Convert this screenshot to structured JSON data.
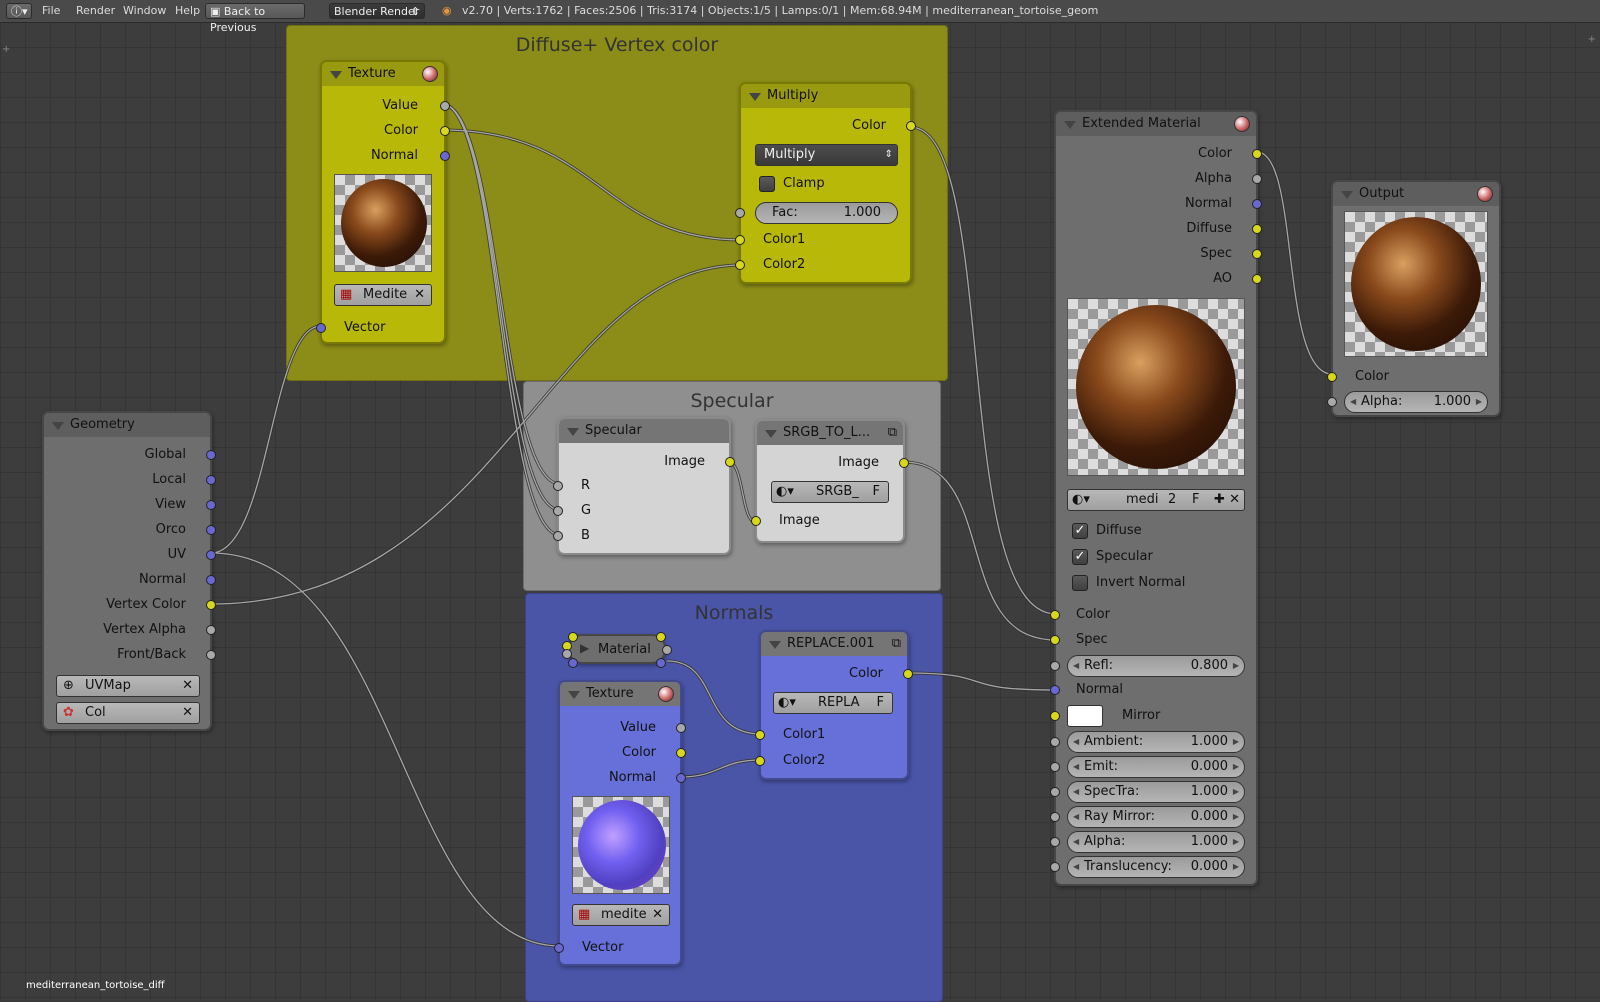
{
  "topbar": {
    "menus": [
      "File",
      "Render",
      "Window",
      "Help"
    ],
    "back_button": "Back to Previous",
    "render_engine": "Blender Render",
    "stats": "v2.70 | Verts:1762 | Faces:2506 | Tris:3174 | Objects:1/5 | Lamps:0/1 | Mem:68.94M | mediterranean_tortoise_geom"
  },
  "frames": {
    "diffuse": "Diffuse+ Vertex color",
    "specular": "Specular",
    "normals": "Normals"
  },
  "colors": {
    "frame_diffuse": "#8c8c18",
    "frame_specular": "#8f8f8f",
    "frame_normals": "#4a55a8",
    "node_yellow": "#b8b808",
    "node_grey": "#d4d4d4",
    "node_blue": "#6670d8",
    "node_dark": "#6e6e6e",
    "socket_yellow": "#d7d71e",
    "socket_grey": "#a8a8a8",
    "socket_blue": "#6868d0"
  },
  "texture_diffuse": {
    "title": "Texture",
    "outputs": [
      "Value",
      "Color",
      "Normal"
    ],
    "image_name": "Medite",
    "input": "Vector"
  },
  "multiply": {
    "title": "Multiply",
    "output": "Color",
    "blend_mode": "Multiply",
    "clamp_label": "Clamp",
    "fac_label": "Fac:",
    "fac_value": "1.000",
    "inputs": [
      "Color1",
      "Color2"
    ]
  },
  "geometry": {
    "title": "Geometry",
    "outputs": [
      "Global",
      "Local",
      "View",
      "Orco",
      "UV",
      "Normal",
      "Vertex Color",
      "Vertex Alpha",
      "Front/Back"
    ],
    "uvmap": "UVMap",
    "col": "Col"
  },
  "specular_node": {
    "title": "Specular",
    "output": "Image",
    "inputs": [
      "R",
      "G",
      "B"
    ]
  },
  "srgb": {
    "title": "SRGB_TO_L...",
    "output": "Image",
    "selector": "SRGB_",
    "f": "F",
    "input": "Image"
  },
  "material_node": {
    "title": "Material"
  },
  "texture_normals": {
    "title": "Texture",
    "outputs": [
      "Value",
      "Color",
      "Normal"
    ],
    "image_name": "medite",
    "input": "Vector"
  },
  "replace": {
    "title": "REPLACE.001",
    "output": "Color",
    "selector": "REPLA",
    "f": "F",
    "inputs": [
      "Color1",
      "Color2"
    ]
  },
  "extended": {
    "title": "Extended Material",
    "outputs": [
      "Color",
      "Alpha",
      "Normal",
      "Diffuse",
      "Spec",
      "AO"
    ],
    "mat_name": "medi",
    "mat_users": "2",
    "f": "F",
    "checks": [
      {
        "label": "Diffuse",
        "checked": true
      },
      {
        "label": "Specular",
        "checked": true
      },
      {
        "label": "Invert Normal",
        "checked": false
      }
    ],
    "inputs": [
      "Color",
      "Spec"
    ],
    "refl_label": "Refl:",
    "refl_value": "0.800",
    "normal_label": "Normal",
    "mirror_label": "Mirror",
    "fields": [
      {
        "label": "Ambient:",
        "value": "1.000"
      },
      {
        "label": "Emit:",
        "value": "0.000"
      },
      {
        "label": "SpecTra:",
        "value": "1.000"
      },
      {
        "label": "Ray Mirror:",
        "value": "0.000"
      },
      {
        "label": "Alpha:",
        "value": "1.000"
      },
      {
        "label": "Translucency:",
        "value": "0.000"
      }
    ]
  },
  "output_node": {
    "title": "Output",
    "color_label": "Color",
    "alpha_label": "Alpha:",
    "alpha_value": "1.000"
  },
  "footer": {
    "material_name": "mediterranean_tortoise_diff"
  }
}
